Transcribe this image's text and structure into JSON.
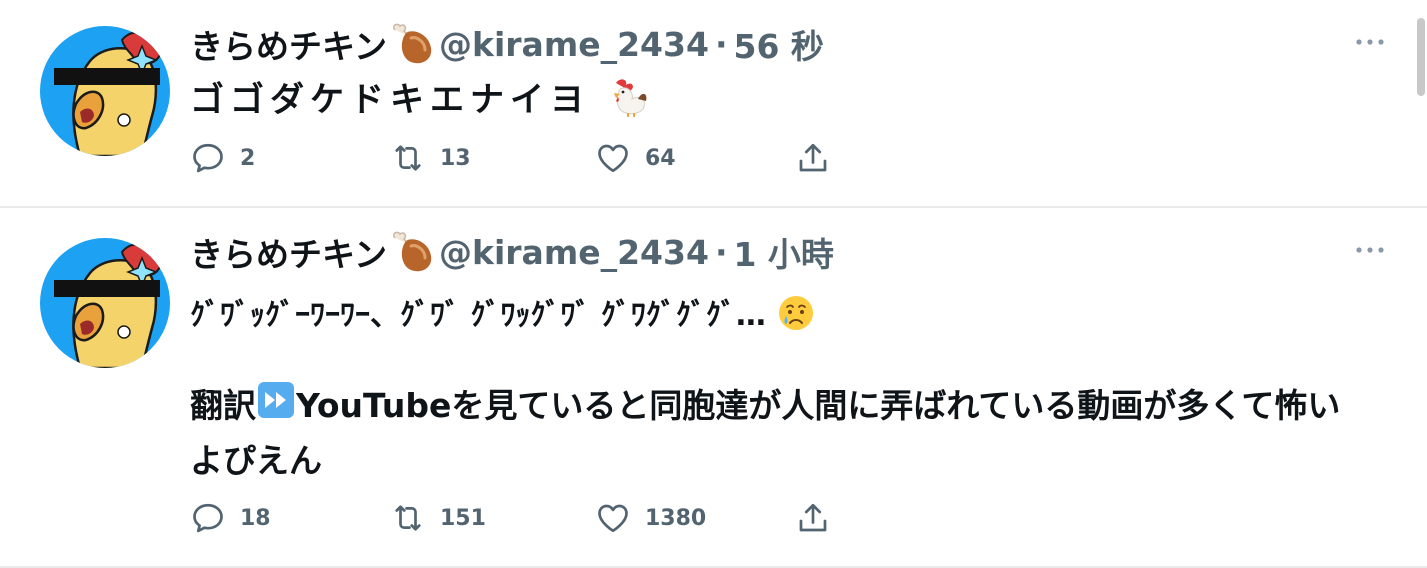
{
  "tweets": [
    {
      "display_name": "きらめチキン",
      "handle": "@kirame_2434",
      "separator": "·",
      "time": "56 秒",
      "text_lines": [
        "ゴゴダケドキエナイヨ"
      ],
      "trailing_emoji": "rooster-emoji",
      "counts": {
        "reply": "2",
        "retweet": "13",
        "like": "64"
      }
    },
    {
      "display_name": "きらめチキン",
      "handle": "@kirame_2434",
      "separator": "·",
      "time": "1 小時",
      "text_lines": [
        "ｸﾞﾜﾞｯｸﾞｰﾜｰﾜｰ、ｸﾞﾜﾞ ｸﾞﾜｯｸﾞﾜﾞ ｸﾞﾜｸﾞｸﾞｸﾞ…",
        "翻訳",
        "YouTubeを見ていると同胞達が人間に弄ばれている動画が多くて怖いよぴえん"
      ],
      "trailing_emoji": "crying-face-emoji",
      "inline_emoji": "fast-forward-emoji",
      "counts": {
        "reply": "18",
        "retweet": "151",
        "like": "1380"
      }
    }
  ],
  "icons": {
    "name_suffix": "drumstick-icon",
    "more": "more-horizontal-icon",
    "reply": "reply-icon",
    "retweet": "retweet-icon",
    "like": "heart-icon",
    "share": "share-icon"
  },
  "colors": {
    "text_primary": "#0f1419",
    "text_secondary": "#536471",
    "divider": "#e7e9ea",
    "avatar_bg": "#1da1f2",
    "chicken_yellow": "#f5d36b",
    "comb_red": "#d93a3a"
  }
}
